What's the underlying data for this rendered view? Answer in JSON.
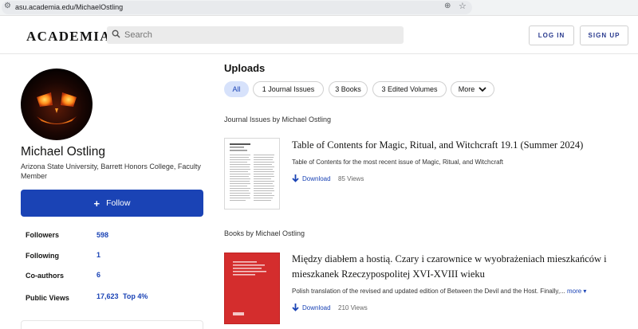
{
  "browser": {
    "url": "asu.academia.edu/MichaelOstling"
  },
  "header": {
    "logo": "ACADEMIA",
    "search_placeholder": "Search",
    "login_label": "LOG IN",
    "signup_label": "SIGN UP"
  },
  "profile": {
    "name": "Michael Ostling",
    "affiliation": "Arizona State University, Barrett Honors College, Faculty Member",
    "follow_label": "Follow",
    "stats": [
      {
        "label": "Followers",
        "value": "598"
      },
      {
        "label": "Following",
        "value": "1"
      },
      {
        "label": "Co-authors",
        "value": "6"
      },
      {
        "label": "Public Views",
        "value": "17,623",
        "extra": "Top 4%"
      }
    ]
  },
  "uploads": {
    "title": "Uploads",
    "filters": [
      {
        "label": "All",
        "active": true
      },
      {
        "label": "1 Journal Issues",
        "active": false
      },
      {
        "label": "3 Books",
        "active": false
      },
      {
        "label": "3 Edited Volumes",
        "active": false
      },
      {
        "label": "More",
        "active": false
      }
    ]
  },
  "sections": [
    {
      "heading": "Journal Issues by Michael Ostling",
      "item": {
        "title": "Table of Contents for Magic, Ritual, and Witchcraft 19.1 (Summer 2024)",
        "description": "Table of Contents for the most recent issue of Magic, Ritual, and Witchcraft",
        "download_label": "Download",
        "views": "85 Views"
      }
    },
    {
      "heading": "Books by Michael Ostling",
      "item": {
        "title_line1": "Między diabłem a hostią. Czary i czarownice w wyobrażeniach mieszkańców i",
        "title_line2": "mieszkanek Rzeczypospolitej XVI-XVIII wieku",
        "description": "Polish translation of the revised and updated edition of Between the Devil and the Host. Finally,...",
        "more_label": "more",
        "download_label": "Download",
        "views": "210 Views"
      }
    }
  ],
  "colors": {
    "accent": "#1a43b5",
    "chip_active_bg": "#d7e2fb",
    "book_cover": "#d42d2d"
  }
}
